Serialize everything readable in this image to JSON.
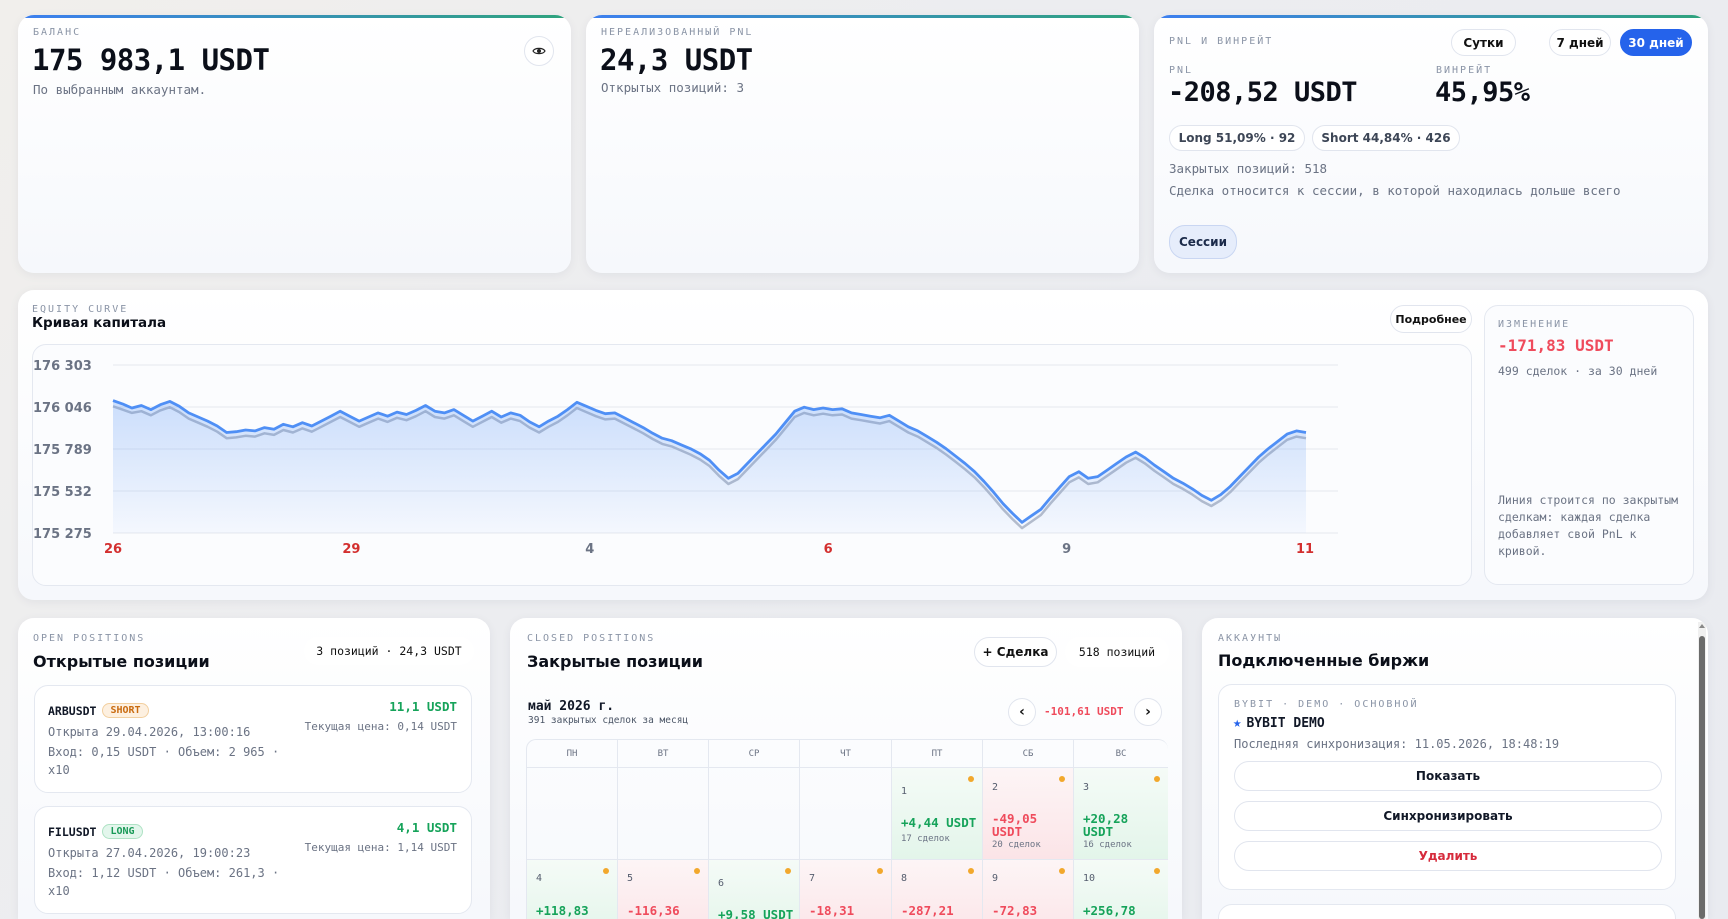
{
  "balance": {
    "eyebrow": "БАЛАНС",
    "value": "175 983,1 USDT",
    "note": "По выбранным аккаунтам."
  },
  "unrealized": {
    "eyebrow": "НЕРЕАЛИЗОВАННЫЙ PNL",
    "value": "24,3 USDT",
    "note": "Открытых позиций: 3"
  },
  "pnl": {
    "eyebrow": "PNL И ВИНРЕЙТ",
    "periods": [
      "Сутки",
      "7 дней",
      "30 дней"
    ],
    "active_period": "30 дней",
    "pnl_label": "PNL",
    "pnl_value": "-208,52 USDT",
    "winrate_label": "ВИНРЕЙТ",
    "winrate_value": "45,95%",
    "long_chip": "Long 51,09% · 92",
    "short_chip": "Short 44,84% · 426",
    "closed": "Закрытых позиций: 518",
    "session_note": "Сделка относится к сессии, в которой находилась дольше всего",
    "sessions_button": "Сессии"
  },
  "equity": {
    "eyebrow": "EQUITY CURVE",
    "title": "Кривая капитала",
    "more_button": "Подробнее",
    "change_eyebrow": "ИЗМЕНЕНИЕ",
    "change_value": "-171,83 USDT",
    "change_note": "499 сделок · за 30 дней",
    "footnote": "Линия строится по закрытым сделкам: каждая сделка добавляет свой PnL к кривой."
  },
  "chart_data": {
    "type": "area",
    "title": "Кривая капитала",
    "xlabel": "",
    "ylabel": "",
    "y_ticks": [
      "176 303",
      "176 046",
      "175 789",
      "175 532",
      "175 275"
    ],
    "x_ticks": [
      "26",
      "29",
      "4",
      "6",
      "9",
      "11"
    ],
    "x_tick_colors": [
      "#d32f2f",
      "#d32f2f",
      "#6b7384",
      "#d32f2f",
      "#6b7384",
      "#d32f2f"
    ],
    "ylim": [
      175275,
      176303
    ],
    "grid": true,
    "series": [
      {
        "color": "#4f8ff5",
        "values": [
          176085,
          176065,
          176040,
          176055,
          176030,
          176060,
          176080,
          176050,
          176010,
          175985,
          175960,
          175930,
          175890,
          175895,
          175905,
          175900,
          175920,
          175910,
          175940,
          175925,
          175950,
          175930,
          175960,
          175990,
          176020,
          175990,
          175960,
          175985,
          176010,
          175990,
          176015,
          176000,
          176025,
          176055,
          176020,
          176010,
          176030,
          175995,
          175960,
          175990,
          176020,
          175985,
          176010,
          175995,
          175955,
          175925,
          175960,
          175990,
          176030,
          176075,
          176050,
          176025,
          176005,
          176010,
          175980,
          175950,
          175920,
          175885,
          175855,
          175840,
          175815,
          175790,
          175760,
          175720,
          175660,
          175610,
          175640,
          175700,
          175760,
          175820,
          175880,
          175950,
          176020,
          176045,
          176030,
          176040,
          176030,
          176035,
          176010,
          176000,
          175990,
          175980,
          175995,
          175960,
          175925,
          175900,
          175865,
          175830,
          175790,
          175745,
          175700,
          175650,
          175590,
          175525,
          175455,
          175395,
          175340,
          175380,
          175420,
          175490,
          175555,
          175620,
          175650,
          175610,
          175620,
          175660,
          175700,
          175740,
          175770,
          175735,
          175690,
          175650,
          175610,
          175580,
          175545,
          175505,
          175475,
          175510,
          175560,
          175620,
          175680,
          175740,
          175790,
          175835,
          175880,
          175900,
          175890
        ]
      },
      {
        "color": "#b9bec9",
        "values": [
          176050,
          176030,
          176010,
          176020,
          175995,
          176025,
          176045,
          176015,
          175975,
          175950,
          175925,
          175895,
          175855,
          175860,
          175870,
          175865,
          175885,
          175875,
          175905,
          175890,
          175915,
          175895,
          175925,
          175955,
          175985,
          175955,
          175925,
          175950,
          175975,
          175955,
          175980,
          175965,
          175990,
          176020,
          175985,
          175975,
          175995,
          175960,
          175925,
          175955,
          175985,
          175950,
          175975,
          175960,
          175920,
          175890,
          175925,
          175955,
          175995,
          176040,
          176015,
          175990,
          175970,
          175975,
          175945,
          175915,
          175885,
          175850,
          175820,
          175805,
          175780,
          175755,
          175725,
          175685,
          175625,
          175575,
          175605,
          175665,
          175725,
          175785,
          175845,
          175915,
          175985,
          176010,
          175995,
          176005,
          175995,
          176000,
          175975,
          175965,
          175955,
          175945,
          175960,
          175925,
          175890,
          175865,
          175830,
          175795,
          175755,
          175710,
          175665,
          175615,
          175555,
          175490,
          175420,
          175360,
          175305,
          175345,
          175385,
          175455,
          175520,
          175585,
          175615,
          175575,
          175585,
          175625,
          175665,
          175705,
          175735,
          175700,
          175655,
          175615,
          175575,
          175545,
          175510,
          175470,
          175440,
          175475,
          175525,
          175585,
          175645,
          175705,
          175755,
          175800,
          175845,
          175865,
          175855
        ]
      }
    ]
  },
  "open_positions": {
    "eyebrow": "OPEN POSITIONS",
    "title": "Открытые позиции",
    "summary": "3 позиций · 24,3 USDT",
    "items": [
      {
        "symbol": "ARBUSDT",
        "side": "SHORT",
        "pnl": "11,1 USDT",
        "opened": "Открыта 29.04.2026, 13:00:16",
        "price": "Текущая цена: 0,14 USDT",
        "details": "Вход: 0,15 USDT · Объем: 2 965 ·",
        "leverage": "x10"
      },
      {
        "symbol": "FILUSDT",
        "side": "LONG",
        "pnl": "4,1 USDT",
        "opened": "Открыта 27.04.2026, 19:00:23",
        "price": "Текущая цена: 1,14 USDT",
        "details": "Вход: 1,12 USDT · Объем: 261,3 ·",
        "leverage": "x10"
      }
    ]
  },
  "closed_positions": {
    "eyebrow": "CLOSED POSITIONS",
    "title": "Закрытые позиции",
    "add_button": "+ Сделка",
    "count": "518 позиций",
    "month": "май 2026 г.",
    "month_note": "391 закрытых сделок за месяц",
    "month_pnl": "-101,61 USDT",
    "prev": "‹",
    "next": "›",
    "weekdays": [
      "ПН",
      "ВТ",
      "СР",
      "ЧТ",
      "ПТ",
      "СБ",
      "ВС"
    ],
    "week1": [
      {
        "day": "1",
        "value": "+4,44 USDT",
        "count": "17 сделок",
        "type": "pos"
      },
      {
        "day": "2",
        "value": "-49,05 USDT",
        "count": "20 сделок",
        "type": "neg"
      },
      {
        "day": "3",
        "value": "+20,28 USDT",
        "count": "16 сделок",
        "type": "pos"
      }
    ],
    "week2": [
      {
        "day": "4",
        "value": "+118,83",
        "type": "pos"
      },
      {
        "day": "5",
        "value": "-116,36",
        "type": "neg"
      },
      {
        "day": "6",
        "value": "+9,58 USDT",
        "type": "pos"
      },
      {
        "day": "7",
        "value": "-18,31",
        "type": "neg"
      },
      {
        "day": "8",
        "value": "-287,21",
        "type": "neg"
      },
      {
        "day": "9",
        "value": "-72,83",
        "type": "neg"
      },
      {
        "day": "10",
        "value": "+256,78",
        "type": "pos"
      }
    ]
  },
  "accounts": {
    "eyebrow": "АККАУНТЫ",
    "title": "Подключенные биржи",
    "account_eyebrow": "BYBIT · DEMO · ОСНОВНОЙ",
    "account_name": "BYBIT DEMO",
    "sync": "Последняя синхронизация: 11.05.2026, 18:48:19",
    "show_button": "Показать",
    "sync_button": "Синхронизировать",
    "delete_button": "Удалить"
  },
  "icons": {
    "eye": "eye-icon",
    "star": "star-icon"
  }
}
